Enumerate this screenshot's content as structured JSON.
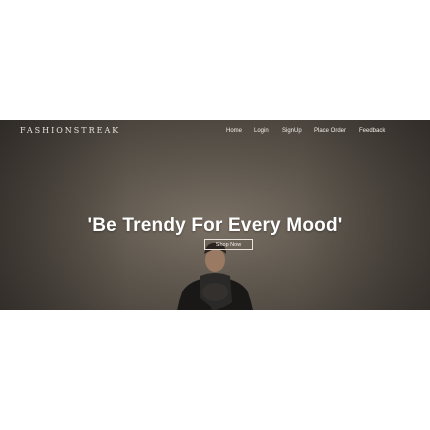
{
  "brand": "FASHIONSTREAK",
  "nav": {
    "home": "Home",
    "login": "Login",
    "signup": "SignUp",
    "place_order": "Place Order",
    "feedback": "Feedback"
  },
  "hero": {
    "headline": "'Be Trendy For Every Mood'",
    "cta": "Shop Now"
  },
  "colors": {
    "hero_bg": "#5c554c",
    "text": "#ffffff"
  }
}
